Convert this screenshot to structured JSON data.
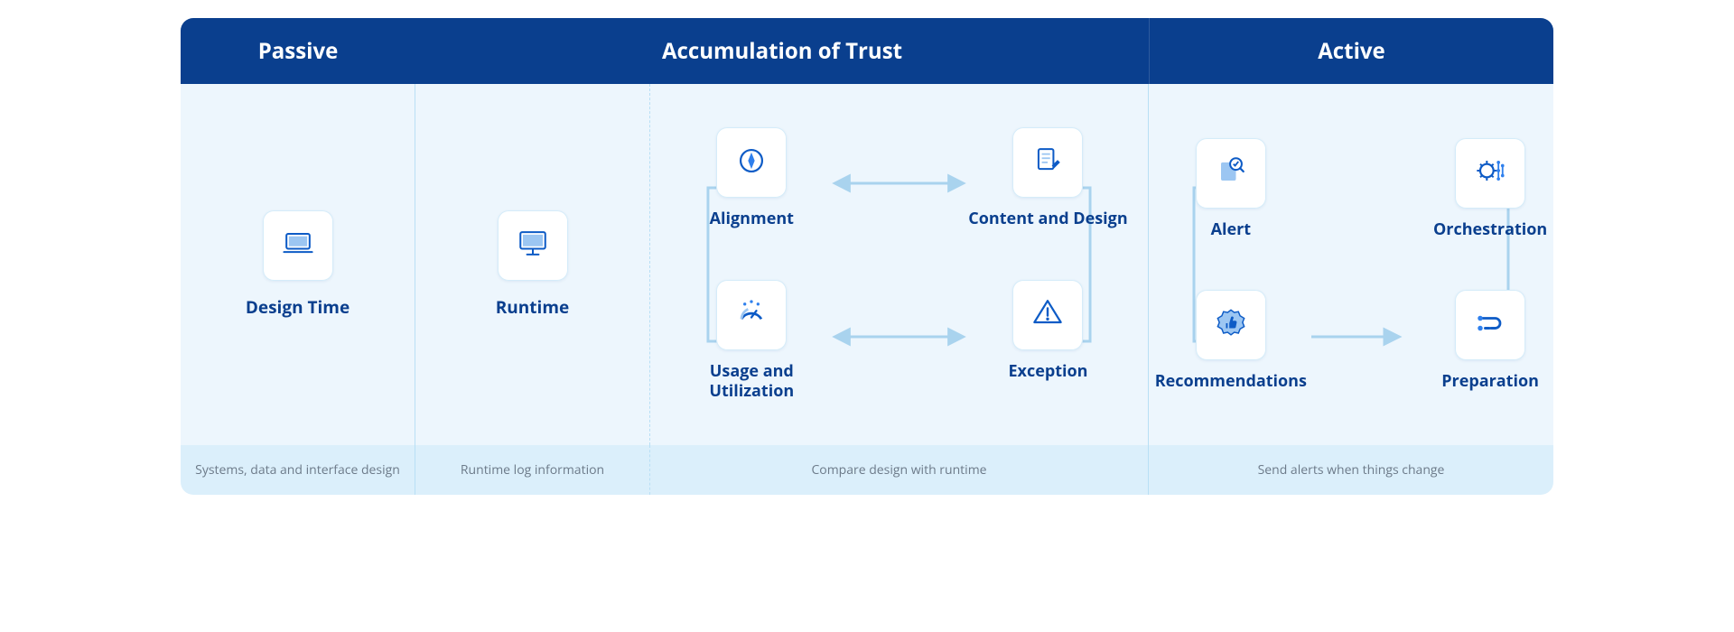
{
  "headers": {
    "passive": "Passive",
    "middle": "Accumulation of Trust",
    "active": "Active"
  },
  "passive": {
    "label": "Design Time",
    "caption": "Systems, data and interface design"
  },
  "runtime": {
    "label": "Runtime",
    "caption": "Runtime log information"
  },
  "compare": {
    "tl": "Alignment",
    "tr": "Content and Design",
    "bl": "Usage and Utilization",
    "br": "Exception",
    "caption": "Compare design with runtime"
  },
  "active": {
    "tl": "Alert",
    "tr": "Orchestration",
    "bl": "Recommendations",
    "br": "Preparation",
    "caption": "Send alerts when things change"
  }
}
